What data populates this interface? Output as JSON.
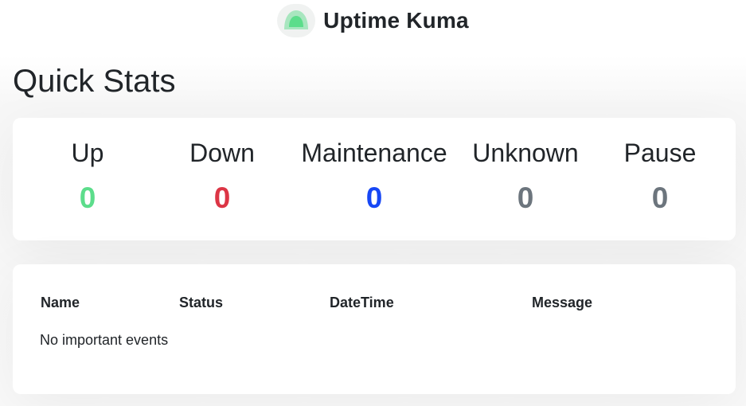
{
  "header": {
    "title": "Uptime Kuma",
    "logo_icon": "uptime-kuma-logo-icon"
  },
  "page": {
    "title": "Quick Stats"
  },
  "stats": [
    {
      "label": "Up",
      "value": "0",
      "color": "#5cdd8b"
    },
    {
      "label": "Down",
      "value": "0",
      "color": "#dc3545"
    },
    {
      "label": "Maintenance",
      "value": "0",
      "color": "#1747f5"
    },
    {
      "label": "Unknown",
      "value": "0",
      "color": "#6c757d"
    },
    {
      "label": "Pause",
      "value": "0",
      "color": "#6c757d"
    }
  ],
  "events": {
    "columns": [
      "Name",
      "Status",
      "DateTime",
      "Message"
    ],
    "empty_message": "No important events"
  }
}
